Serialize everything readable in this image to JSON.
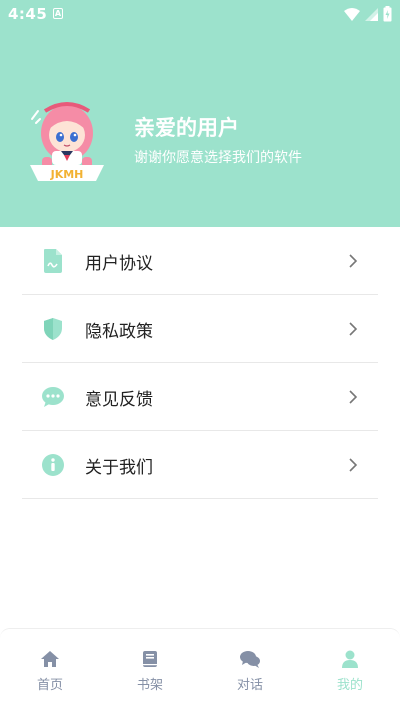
{
  "status": {
    "time": "4:45",
    "notification_glyph": "A"
  },
  "profile": {
    "title": "亲爱的用户",
    "subtitle": "谢谢你愿意选择我们的软件",
    "avatar_text": "JKMH"
  },
  "menu": {
    "items": [
      {
        "label": "用户协议",
        "icon": "document-icon"
      },
      {
        "label": "隐私政策",
        "icon": "shield-icon"
      },
      {
        "label": "意见反馈",
        "icon": "chat-bubble-icon"
      },
      {
        "label": "关于我们",
        "icon": "info-icon"
      }
    ]
  },
  "tabbar": {
    "tabs": [
      {
        "label": "首页",
        "icon": "home-icon"
      },
      {
        "label": "书架",
        "icon": "book-icon"
      },
      {
        "label": "对话",
        "icon": "chat-icon"
      },
      {
        "label": "我的",
        "icon": "user-icon",
        "active": true
      }
    ]
  },
  "colors": {
    "accent": "#9ce2cc",
    "tab_inactive": "#8590a6",
    "text": "#222222"
  }
}
